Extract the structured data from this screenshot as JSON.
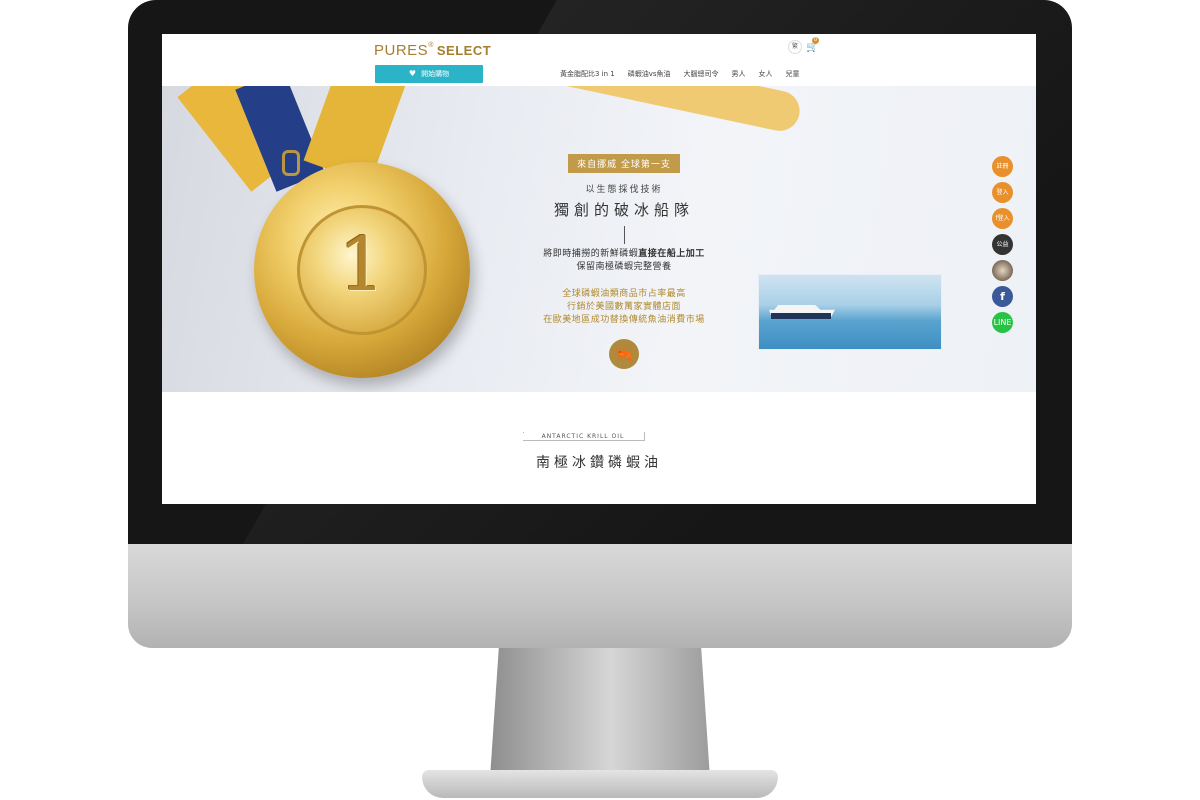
{
  "header": {
    "logo_text": "PURES",
    "logo_reg": "®",
    "logo_select": "SELECT",
    "cta_label": "開始購物",
    "lang_label": "繁",
    "cart_count": "0"
  },
  "nav": {
    "items": [
      "黃金脂配比3 in 1",
      "磷蝦油vs魚油",
      "大腦總司令",
      "男人",
      "女人",
      "兒童"
    ]
  },
  "hero": {
    "tag": "來自挪威 全球第一支",
    "subtitle": "以生態採伐技術",
    "title": "獨創的破冰船隊",
    "body_line1_prefix": "將即時捕撈的新鮮磷蝦",
    "body_line1_bold": "直接在船上加工",
    "body_line2": "保留南極磷蝦完整營養",
    "gold_lines": [
      "全球磷蝦油類商品市占率最高",
      "行銷於美國數萬家實體店面",
      "在歐美地區成功替換傳統魚油消費市場"
    ],
    "medal_number": "1"
  },
  "side_buttons": {
    "items": [
      {
        "label": "註冊",
        "style": "orange"
      },
      {
        "label": "登入",
        "style": "orange"
      },
      {
        "label": "f登入",
        "style": "orange"
      },
      {
        "label": "公益",
        "style": "dark"
      },
      {
        "label": "",
        "style": "photo"
      },
      {
        "label": "f",
        "style": "fb"
      },
      {
        "label": "LINE",
        "style": "line"
      }
    ]
  },
  "section": {
    "eyebrow": "ANTARCTIC KRILL OIL",
    "title": "南極冰鑽磷蝦油"
  }
}
